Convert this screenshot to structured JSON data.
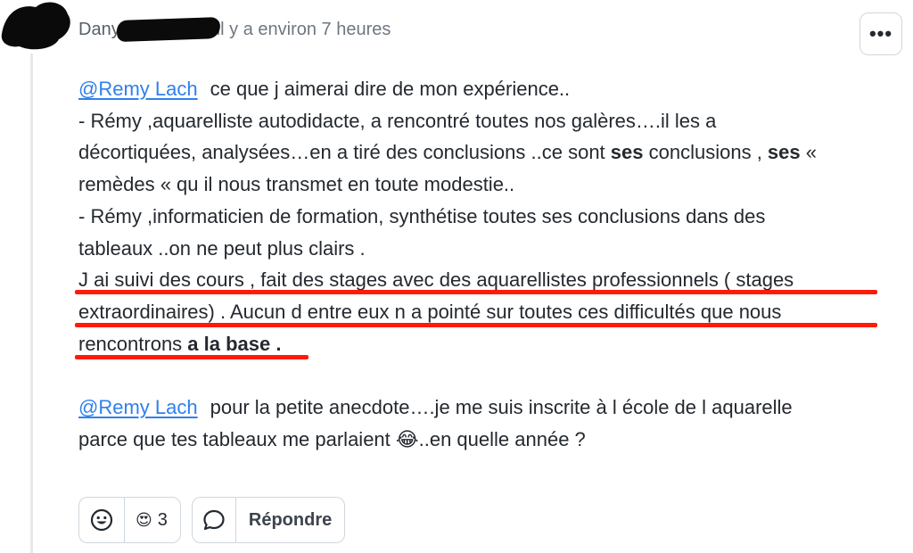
{
  "author": {
    "name": "Dany",
    "timestamp": "il y a environ 7 heures"
  },
  "menu": {
    "more_label": "•••"
  },
  "paragraph1": {
    "mention": "@Remy Lach",
    "line1": "ce que j aimerai dire de mon expérience..",
    "line2": "- Rémy ,aquarelliste autodidacte, a rencontré toutes nos galères….il les a",
    "line3a": "décortiquées, analysées…en a tiré des conclusions ..ce sont ",
    "line3b": "ses",
    "line3c": " conclusions , ",
    "line3d": "ses",
    "line3e": " «",
    "line4": "remèdes «  qu il nous transmet en toute modestie..",
    "line5": "- Rémy ,informaticien de formation, synthétise toutes ses conclusions dans des",
    "line6": "tableaux ..on ne peut plus clairs .",
    "line7": "J ai suivi des cours , fait des stages avec des aquarellistes professionnels ( stages",
    "line8": "extraordinaires) . Aucun d entre eux n a pointé sur toutes ces difficultés que nous",
    "line9a": "rencontrons ",
    "line9b": "a la base ."
  },
  "paragraph2": {
    "mention": "@Remy Lach",
    "line1": "pour la petite anecdote….je me suis inscrite à l école de l aquarelle",
    "line2a": "parce que tes tableaux me parlaient ",
    "line2_emoji": "😂",
    "line2b": "..en quelle année ?"
  },
  "reactions": {
    "emoji": "😍",
    "count": "3",
    "add_icon": "smiley-icon"
  },
  "reply": {
    "label": "Répondre",
    "icon": "speech-bubble-icon"
  },
  "colors": {
    "mention": "#2f80ed",
    "underline": "#ff1a0a",
    "border": "#d0d7de"
  }
}
